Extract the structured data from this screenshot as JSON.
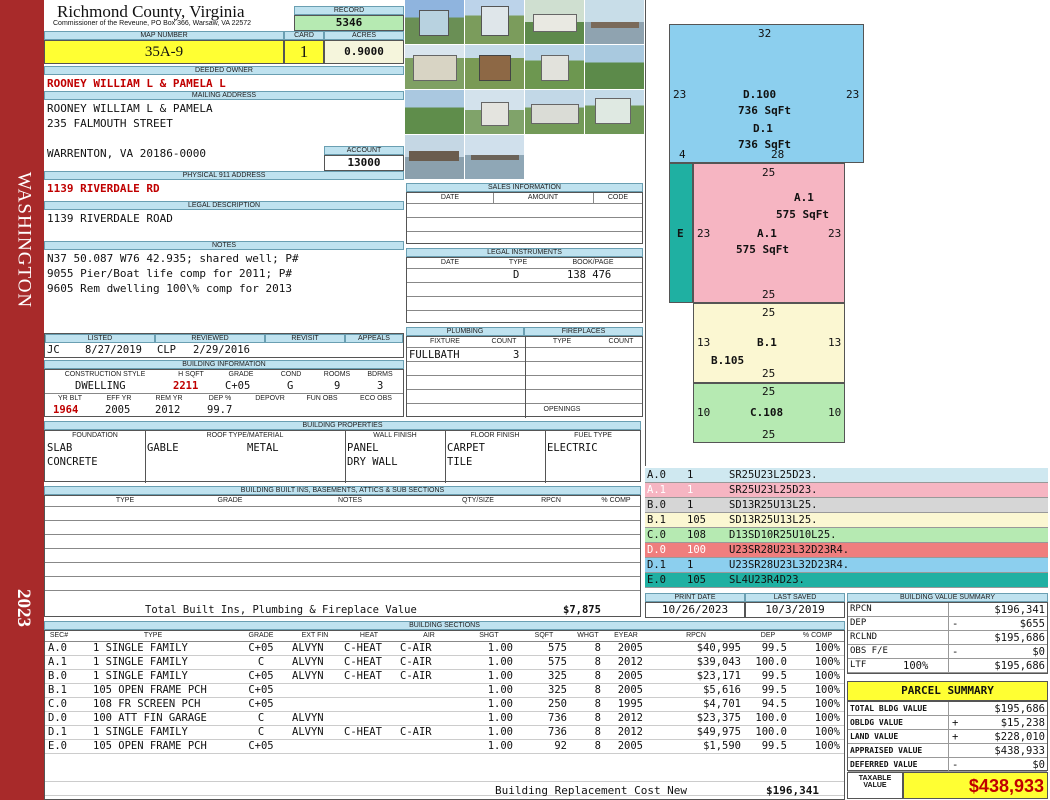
{
  "sidebar": {
    "district": "WASHINGTON",
    "year": "2023",
    "color": "#a82a2a"
  },
  "header": {
    "county": "Richmond County, Virginia",
    "commissioner": "Commissioner of the Reveune, PO Box 366, Warsaw, VA 22572"
  },
  "record": {
    "label": "RECORD",
    "value": "5346"
  },
  "acres": {
    "label": "ACRES",
    "value": "0.9000"
  },
  "map": {
    "label": "MAP NUMBER",
    "value": "35A-9"
  },
  "card": {
    "label": "CARD",
    "value": "1"
  },
  "owner": {
    "label": "DEEDED OWNER",
    "value": "ROONEY WILLIAM L & PAMELA L"
  },
  "mailing": {
    "label": "MAILING ADDRESS",
    "line1": "ROONEY WILLIAM L & PAMELA",
    "line2": "235 FALMOUTH STREET",
    "line3": "WARRENTON, VA 20186-0000"
  },
  "account": {
    "label": "ACCOUNT",
    "value": "13000"
  },
  "physical": {
    "label": "PHYSICAL 911 ADDRESS",
    "value": "1139 RIVERDALE RD"
  },
  "legal": {
    "label": "LEGAL DESCRIPTION",
    "value": "1139 RIVERDALE ROAD"
  },
  "notes": {
    "label": "NOTES",
    "lines": [
      "N37 50.087 W76 42.935; shared well; P#",
      "9055 Pier/Boat life comp for 2011; P#",
      "9605 Rem dwelling 100\\% comp for 2013"
    ]
  },
  "listing": {
    "listed_label": "LISTED",
    "reviewed_label": "REVIEWED",
    "revisit_label": "REVISIT",
    "appeals_label": "APPEALS",
    "listed_by": "JC",
    "listed_date": "8/27/2019",
    "reviewed_by": "CLP",
    "reviewed_date": "2/29/2016"
  },
  "building_info": {
    "label": "BUILDING INFORMATION",
    "h_style": "CONSTRUCTION STYLE",
    "h_sqft": "H SQFT",
    "h_grade": "GRADE",
    "h_cond": "COND",
    "h_rooms": "ROOMS",
    "h_bdrms": "BDRMS",
    "style": "DWELLING",
    "sqft": "2211",
    "grade": "C+05",
    "cond": "G",
    "rooms": "9",
    "bdrms": "3",
    "h_yrblt": "YR BLT",
    "h_effyr": "EFF YR",
    "h_remyr": "REM YR",
    "h_dep": "DEP %",
    "h_depovr": "DEPOVR",
    "h_funobs": "FUN OBS",
    "h_ecoobs": "ECO OBS",
    "yrblt": "1964",
    "effyr": "2005",
    "remyr": "2012",
    "dep": "99.7"
  },
  "sales": {
    "label": "SALES INFORMATION",
    "h_date": "DATE",
    "h_amount": "AMOUNT",
    "h_code": "CODE"
  },
  "instruments": {
    "label": "LEGAL INSTRUMENTS",
    "h_date": "DATE",
    "h_type": "TYPE",
    "h_book": "BOOK/PAGE",
    "type": "D",
    "book": "138 476"
  },
  "plumbing": {
    "label": "PLUMBING",
    "h_fixture": "FIXTURE",
    "h_count": "COUNT",
    "fixture": "FULLBATH",
    "count": "3"
  },
  "fireplaces": {
    "label": "FIREPLACES",
    "h_type": "TYPE",
    "h_count": "COUNT",
    "openings": "OPENINGS"
  },
  "properties": {
    "label": "BUILDING PROPERTIES",
    "h_foundation": "FOUNDATION",
    "h_roof": "ROOF TYPE/MATERIAL",
    "h_wall": "WALL FINISH",
    "h_floor": "FLOOR FINISH",
    "h_fuel": "FUEL TYPE",
    "foundation1": "SLAB",
    "foundation2": "CONCRETE",
    "roof1": "GABLE",
    "roof2": "METAL",
    "wall1": "PANEL",
    "wall2": "DRY WALL",
    "floor1": "CARPET",
    "floor2": "TILE",
    "fuel": "ELECTRIC"
  },
  "builtins": {
    "label": "BUILDING BUILT INS, BASEMENTS, ATTICS & SUB SECTIONS",
    "h_type": "TYPE",
    "h_grade": "GRADE",
    "h_notes": "NOTES",
    "h_qty": "QTY/SIZE",
    "h_rpcn": "RPCN",
    "h_comp": "% COMP",
    "total_label": "Total Built Ins, Plumbing & Fireplace Value",
    "total_value": "$7,875"
  },
  "sketch": {
    "segments": [
      {
        "label": "32"
      },
      {
        "label": "23"
      },
      {
        "label": "23"
      },
      {
        "label": "D.100"
      },
      {
        "label": "736 SqFt"
      },
      {
        "label": "D.1"
      },
      {
        "label": "736 SqFt"
      },
      {
        "label": "4"
      },
      {
        "label": "28"
      },
      {
        "label": "25"
      },
      {
        "label": "A.1"
      },
      {
        "label": "575 SqFt"
      },
      {
        "label": "E"
      },
      {
        "label": "23"
      },
      {
        "label": "A.1"
      },
      {
        "label": "23"
      },
      {
        "label": "575 SqFt"
      },
      {
        "label": "25"
      },
      {
        "label": "25"
      },
      {
        "label": "13"
      },
      {
        "label": "B.1"
      },
      {
        "label": "13"
      },
      {
        "label": "B.105"
      },
      {
        "label": "25"
      },
      {
        "label": "25"
      },
      {
        "label": "10"
      },
      {
        "label": "C.108"
      },
      {
        "label": "10"
      },
      {
        "label": "25"
      }
    ]
  },
  "traverse": [
    {
      "code": "A.0",
      "num": "1",
      "path": "SR25U23L25D23.",
      "color": "#cfe8f0"
    },
    {
      "code": "A.1",
      "num": "1",
      "path": "SR25U23L25D23.",
      "color": "#f6b5c2"
    },
    {
      "code": "B.0",
      "num": "1",
      "path": "SD13R25U13L25.",
      "color": "#d6d6d6"
    },
    {
      "code": "B.1",
      "num": "105",
      "path": "SD13R25U13L25.",
      "color": "#fbf7d2"
    },
    {
      "code": "C.0",
      "num": "108",
      "path": "D13SD10R25U10L25.",
      "color": "#b6eab2"
    },
    {
      "code": "D.0",
      "num": "100",
      "path": "U23SR28U23L32D23R4.",
      "color": "#ef7e7e"
    },
    {
      "code": "D.1",
      "num": "1",
      "path": "U23SR28U23L32D23R4.",
      "color": "#8ccfee"
    },
    {
      "code": "E.0",
      "num": "105",
      "path": "SL4U23R4D23.",
      "color": "#1fb0a2"
    }
  ],
  "print": {
    "print_label": "PRINT DATE",
    "print_value": "10/26/2023",
    "saved_label": "LAST SAVED",
    "saved_value": "10/3/2019"
  },
  "bvs": {
    "label": "BUILDING VALUE SUMMARY",
    "rows": [
      {
        "name": "RPCN",
        "pre": "",
        "value": "$196,341"
      },
      {
        "name": "DEP",
        "pre": "-",
        "value": "$655"
      },
      {
        "name": "RCLND",
        "pre": "",
        "value": "$195,686"
      },
      {
        "name": "OBS F/E",
        "pre": "-",
        "value": "$0"
      },
      {
        "name": "LTF",
        "pre": "100%",
        "value": "$195,686"
      }
    ]
  },
  "parcel": {
    "label": "PARCEL SUMMARY",
    "rows": [
      {
        "name": "TOTAL BLDG VALUE",
        "pre": "",
        "value": "$195,686"
      },
      {
        "name": "OBLDG VALUE",
        "pre": "+",
        "value": "$15,238"
      },
      {
        "name": "LAND VALUE",
        "pre": "+",
        "value": "$228,010"
      },
      {
        "name": "APPRAISED VALUE",
        "pre": "",
        "value": "$438,933"
      },
      {
        "name": "DEFERRED VALUE",
        "pre": "-",
        "value": "$0"
      }
    ],
    "taxable_label": "TAXABLE VALUE",
    "taxable_value": "$438,933"
  },
  "sections": {
    "label": "BUILDING SECTIONS",
    "headers": [
      "SEC#",
      "TYPE",
      "GRADE",
      "EXT FIN",
      "HEAT",
      "AIR",
      "SHGT",
      "SQFT",
      "WHGT",
      "EYEAR",
      "RPCN",
      "DEP",
      "% COMP"
    ],
    "rows": [
      [
        "A.0",
        "1 SINGLE FAMILY",
        "C+05",
        "ALVYN",
        "C-HEAT",
        "C-AIR",
        "1.00",
        "575",
        "8",
        "2005",
        "$40,995",
        "99.5",
        "100%"
      ],
      [
        "A.1",
        "1 SINGLE FAMILY",
        "C",
        "ALVYN",
        "C-HEAT",
        "C-AIR",
        "1.00",
        "575",
        "8",
        "2012",
        "$39,043",
        "100.0",
        "100%"
      ],
      [
        "B.0",
        "1 SINGLE FAMILY",
        "C+05",
        "ALVYN",
        "C-HEAT",
        "C-AIR",
        "1.00",
        "325",
        "8",
        "2005",
        "$23,171",
        "99.5",
        "100%"
      ],
      [
        "B.1",
        "105 OPEN FRAME PCH",
        "C+05",
        "",
        "",
        "",
        "1.00",
        "325",
        "8",
        "2005",
        "$5,616",
        "99.5",
        "100%"
      ],
      [
        "C.0",
        "108 FR SCREEN PCH",
        "C+05",
        "",
        "",
        "",
        "1.00",
        "250",
        "8",
        "1995",
        "$4,701",
        "94.5",
        "100%"
      ],
      [
        "D.0",
        "100 ATT FIN GARAGE",
        "C",
        "ALVYN",
        "",
        "",
        "1.00",
        "736",
        "8",
        "2012",
        "$23,375",
        "100.0",
        "100%"
      ],
      [
        "D.1",
        "1 SINGLE FAMILY",
        "C",
        "ALVYN",
        "C-HEAT",
        "C-AIR",
        "1.00",
        "736",
        "8",
        "2012",
        "$49,975",
        "100.0",
        "100%"
      ],
      [
        "E.0",
        "105 OPEN FRAME PCH",
        "C+05",
        "",
        "",
        "",
        "1.00",
        "92",
        "8",
        "2005",
        "$1,590",
        "99.5",
        "100%"
      ]
    ],
    "brcn_label": "Building Replacement Cost New",
    "brcn_value": "$196,341"
  }
}
